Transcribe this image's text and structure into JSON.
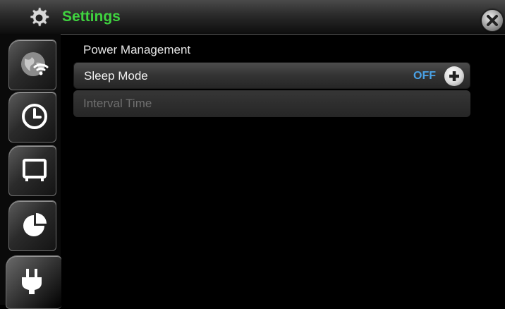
{
  "header": {
    "title": "Settings",
    "icon": "gear-icon",
    "close_icon": "close-icon",
    "title_color": "#3fd23f"
  },
  "sidebar": {
    "tabs": [
      {
        "name": "network",
        "icon": "globe-wifi-icon"
      },
      {
        "name": "time",
        "icon": "clock-icon"
      },
      {
        "name": "display",
        "icon": "monitor-icon"
      },
      {
        "name": "storage",
        "icon": "pie-chart-icon"
      },
      {
        "name": "power",
        "icon": "power-plug-icon",
        "active": true
      }
    ]
  },
  "main": {
    "section_title": "Power Management",
    "rows": [
      {
        "label": "Sleep Mode",
        "value": "OFF",
        "enabled": true
      },
      {
        "label": "Interval Time",
        "enabled": false
      }
    ],
    "value_color": "#4aa3e8"
  }
}
